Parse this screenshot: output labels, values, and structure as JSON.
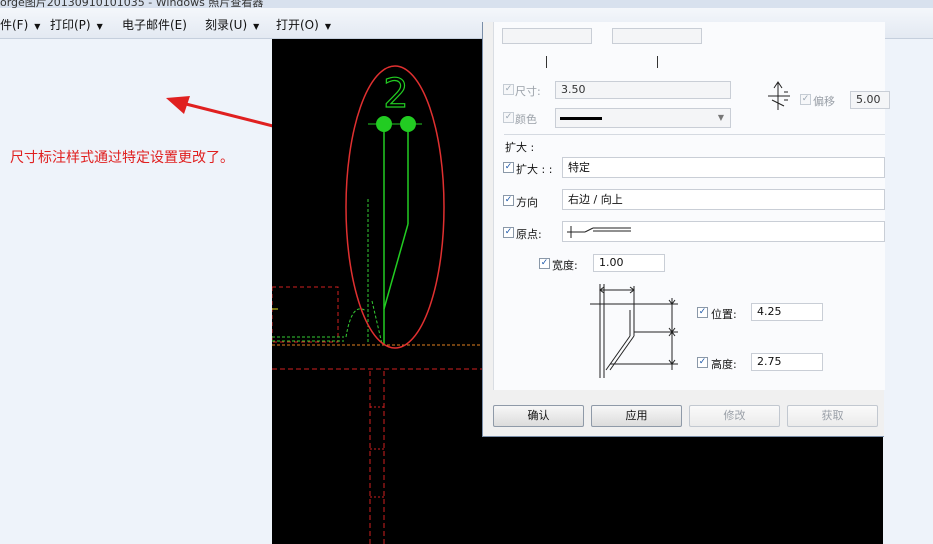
{
  "window": {
    "title": "orge图片20130910101035 - Windows 照片查看器"
  },
  "menu": [
    {
      "label": "件(F)",
      "has_arrow": true
    },
    {
      "label": "打印(P)",
      "has_arrow": true
    },
    {
      "label": "电子邮件(E)",
      "has_arrow": false
    },
    {
      "label": "刻录(U)",
      "has_arrow": true
    },
    {
      "label": "打开(O)",
      "has_arrow": true
    }
  ],
  "annotation": {
    "text": "尺寸标注样式通过特定设置更改了。",
    "color": "#e02020"
  },
  "cad": {
    "dimension_text": "2",
    "accent": "#22cc22",
    "highlight_ellipse": "#e03030"
  },
  "dialog": {
    "size_label": "尺寸:",
    "size_value": "3.50",
    "offset_label": "偏移",
    "offset_value": "5.00",
    "color_label": "颜色",
    "extend_section": "扩大 :",
    "extend_label": "扩大 : :",
    "extend_value": "特定",
    "direction_label": "方向",
    "direction_value": "右边 / 向上",
    "origin_label": "原点:",
    "width_label": "宽度:",
    "width_value": "1.00",
    "position_label": "位置:",
    "position_value": "4.25",
    "height_label": "高度:",
    "height_value": "2.75",
    "buttons": {
      "ok": "确认",
      "apply": "应用",
      "modify": "修改",
      "get": "获取"
    }
  }
}
